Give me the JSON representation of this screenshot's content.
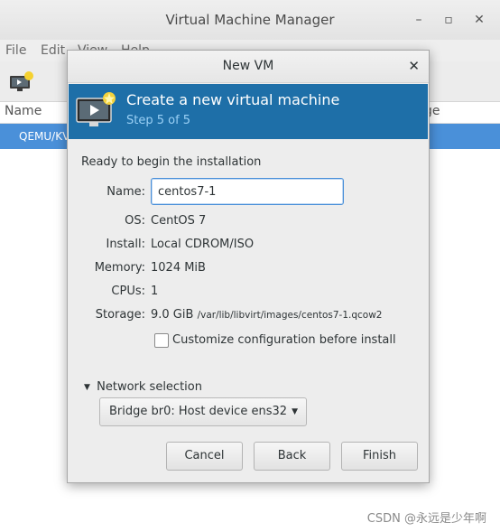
{
  "main_window": {
    "title": "Virtual Machine Manager",
    "menu": [
      "File",
      "Edit",
      "View",
      "Help"
    ],
    "columns": {
      "name": "Name",
      "usage": "ge"
    },
    "selected_row": "QEMU/KV"
  },
  "dialog": {
    "title": "New VM",
    "banner": {
      "title": "Create a new virtual machine",
      "step": "Step 5 of 5"
    },
    "ready_text": "Ready to begin the installation",
    "fields": {
      "name": {
        "label": "Name:",
        "value": "centos7-1"
      },
      "os": {
        "label": "OS:",
        "value": "CentOS 7"
      },
      "install": {
        "label": "Install:",
        "value": "Local CDROM/ISO"
      },
      "memory": {
        "label": "Memory:",
        "value": "1024 MiB"
      },
      "cpus": {
        "label": "CPUs:",
        "value": "1"
      },
      "storage": {
        "label": "Storage:",
        "value": "9.0 GiB",
        "path": "/var/lib/libvirt/images/centos7-1.qcow2"
      }
    },
    "customize_checkbox": {
      "label": "Customize configuration before install",
      "checked": false
    },
    "network": {
      "expander_label": "Network selection",
      "selected": "Bridge br0: Host device ens32"
    },
    "buttons": {
      "cancel": "Cancel",
      "back": "Back",
      "finish": "Finish"
    }
  },
  "watermark": "CSDN @永远是少年啊",
  "colors": {
    "banner_bg": "#1e6fa8",
    "banner_step": "#9ad0f5",
    "selection": "#4a90d9"
  }
}
